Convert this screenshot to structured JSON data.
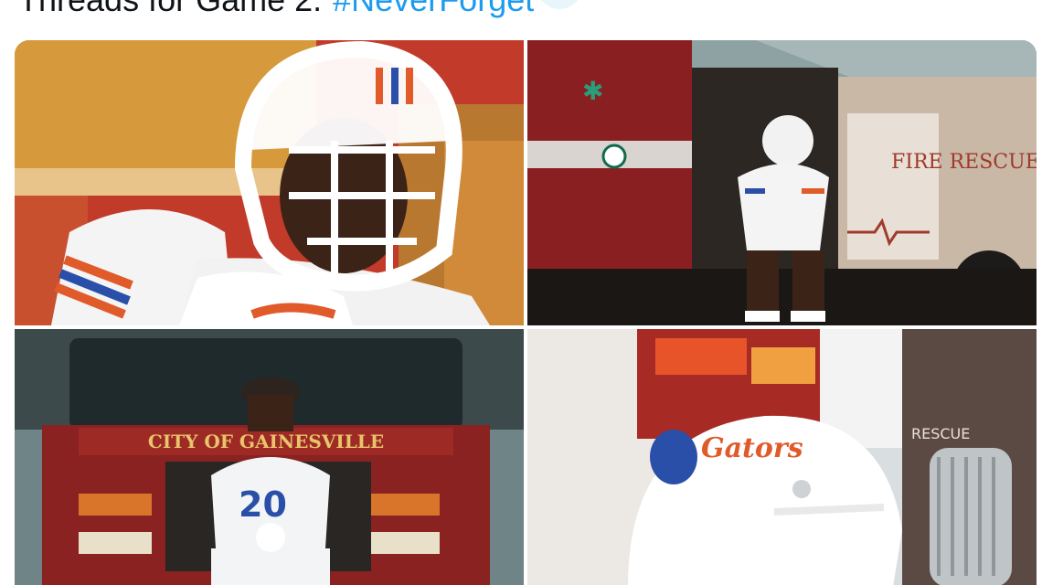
{
  "tweet": {
    "text": "Threads for Game 2.",
    "hashtag": "#NeverForget",
    "emoji": "firefighter-emoji"
  },
  "photos": {
    "fire_truck_sign": "CITY OF GAINESVILLE",
    "truck_side_text": "FIRE RESCUE",
    "helmet_script": "Gators",
    "jersey_number": "20",
    "rescue_text": "RESCUE"
  }
}
